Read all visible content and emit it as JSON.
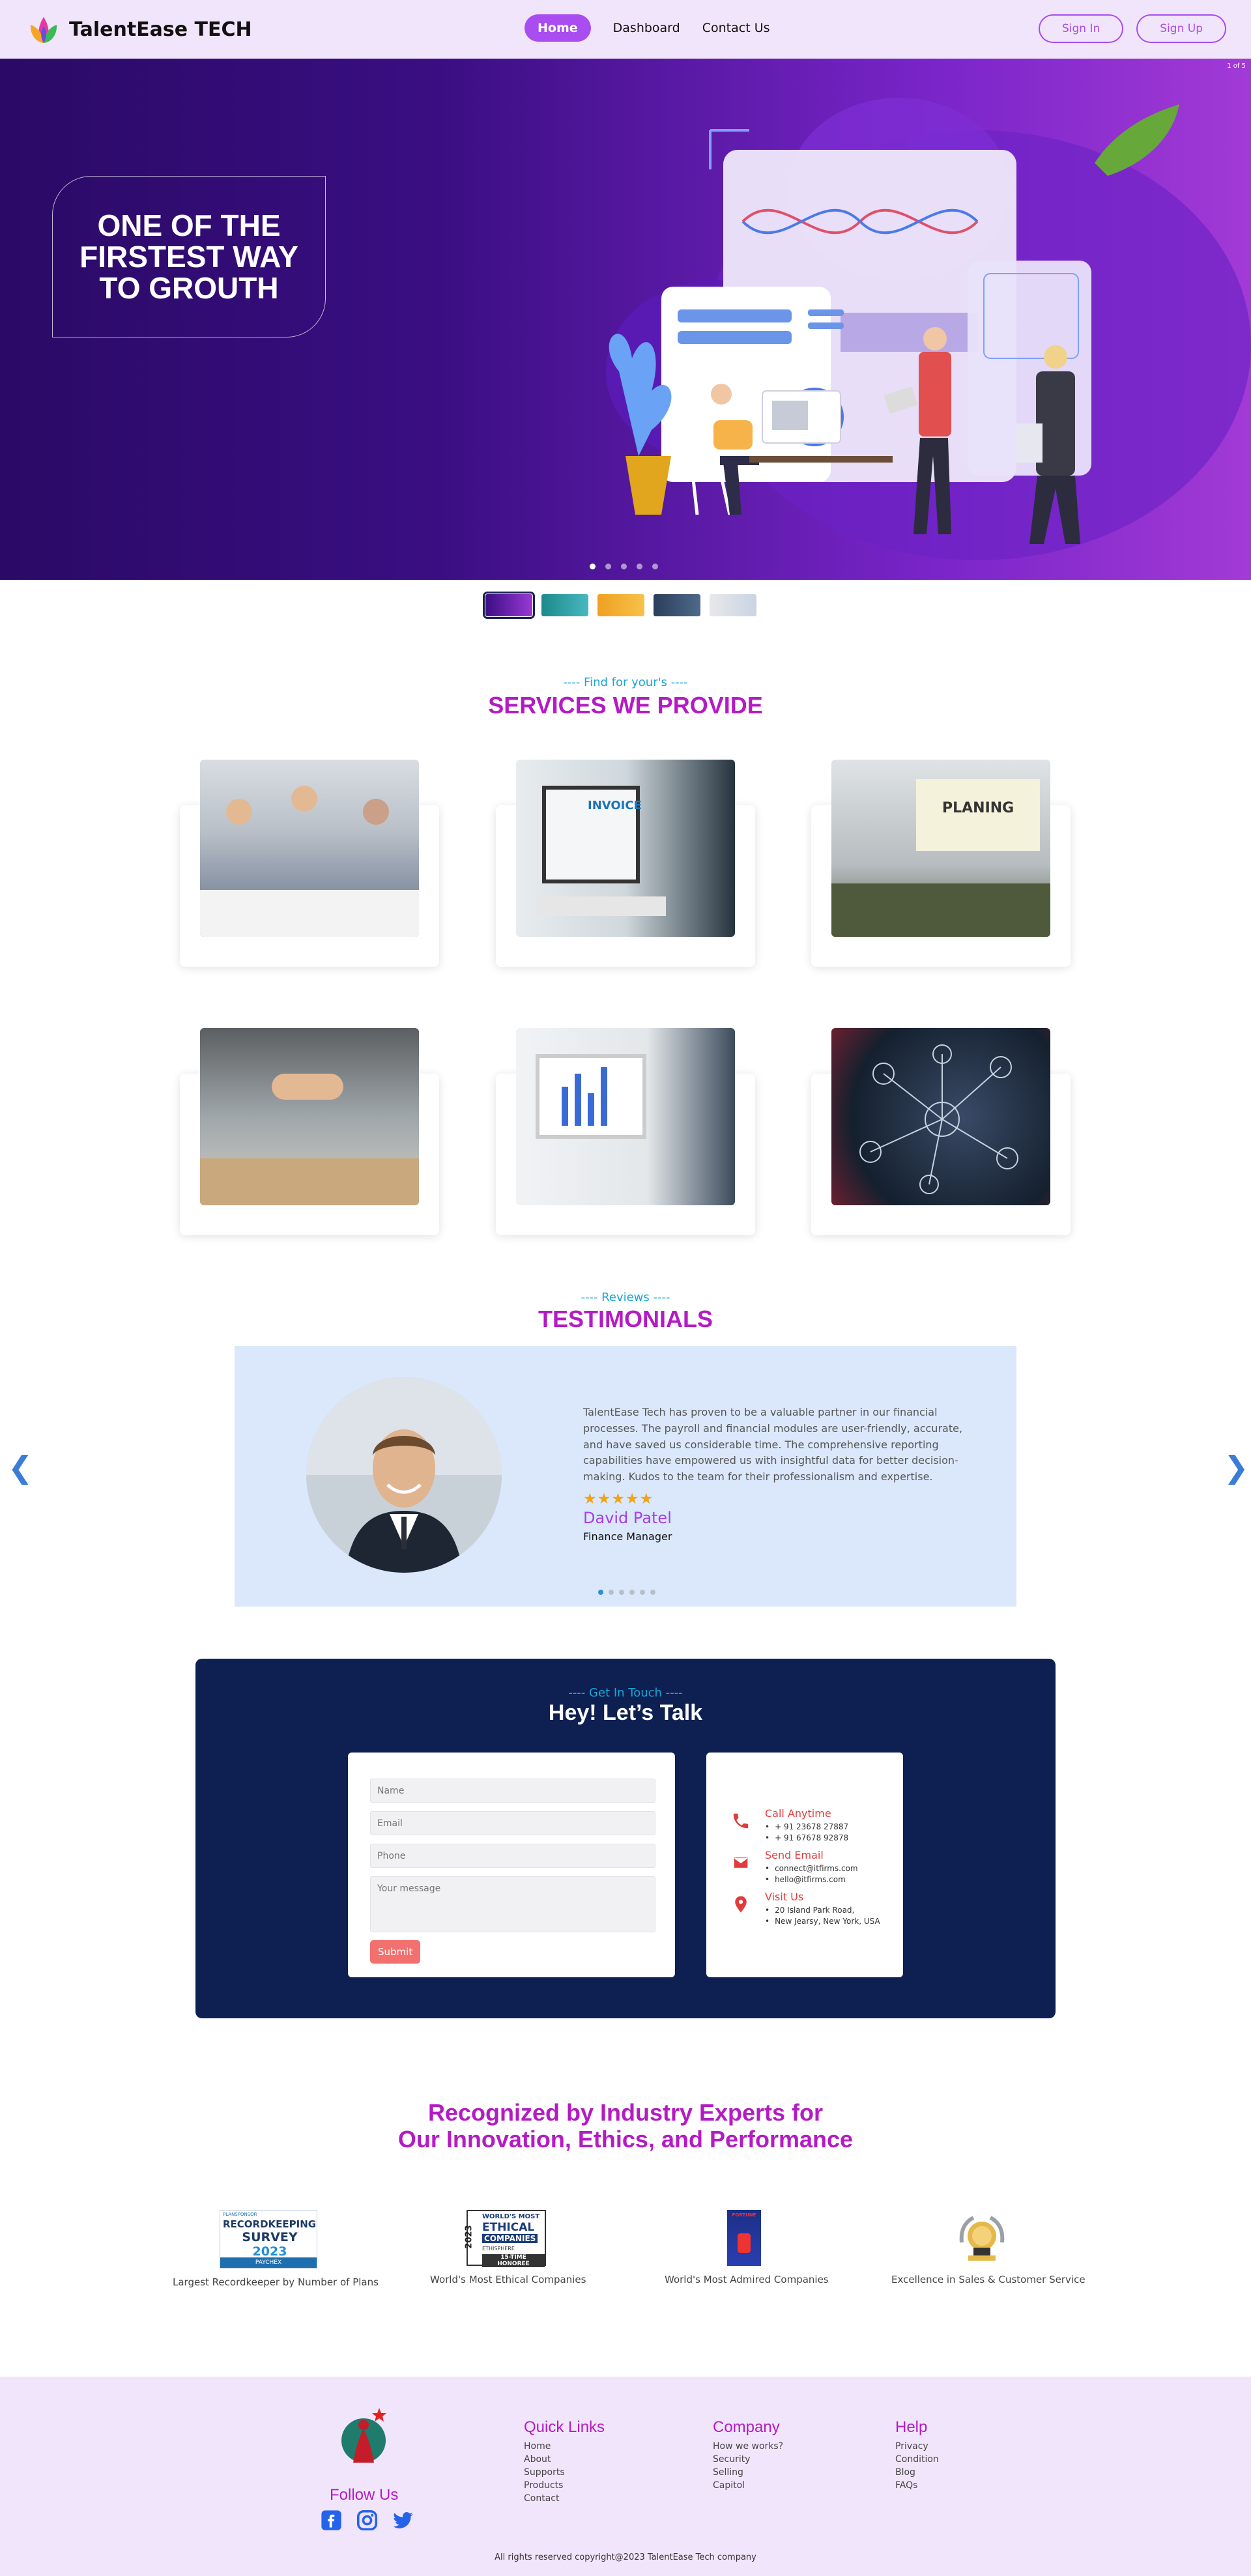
{
  "brand": {
    "name": "TalentEase TECH"
  },
  "nav": {
    "links": [
      {
        "label": "Home",
        "active": true
      },
      {
        "label": "Dashboard"
      },
      {
        "label": "Contact Us"
      }
    ],
    "signin": "Sign In",
    "signup": "Sign Up"
  },
  "hero": {
    "title": "ONE OF THE FIRSTEST WAY TO GROUTH",
    "counter": "1 of 5",
    "slides": 5,
    "active_slide": 1
  },
  "services": {
    "eyebrow": "---- Find for your's ----",
    "title": "SERVICES WE PROVIDE"
  },
  "testimonials": {
    "eyebrow": "---- Reviews ----",
    "title": "TESTIMONIALS",
    "quote": "TalentEase Tech has proven to be a valuable partner in our financial processes. The payroll and financial modules are user-friendly, accurate, and have saved us considerable time. The comprehensive reporting capabilities have empowered us with insightful data for better decision-making. Kudos to the team for their professionalism and expertise.",
    "stars": "★★★★★",
    "rating": 5,
    "name": "David Patel",
    "role": "Finance Manager",
    "pages": 6,
    "active_page": 1,
    "prev": "❮",
    "next": "❯"
  },
  "contact": {
    "eyebrow": "---- Get In Touch ----",
    "title": "Hey! Let’s Talk",
    "form": {
      "name_placeholder": "Name",
      "email_placeholder": "Email",
      "phone_placeholder": "Phone",
      "message_placeholder": "Your message",
      "submit": "Submit"
    },
    "call": {
      "title": "Call Anytime",
      "lines": [
        "+ 91 23678 27887",
        "+ 91 67678 92878"
      ]
    },
    "email": {
      "title": "Send Email",
      "lines": [
        "connect@itfirms.com",
        "hello@itfirms.com"
      ]
    },
    "visit": {
      "title": "Visit Us",
      "lines": [
        "20 Island Park Road,",
        "New Jearsy, New York, USA"
      ]
    }
  },
  "recognized": {
    "line1": "Recognized by Industry Experts for",
    "line2": "Our Innovation, Ethics, and Performance",
    "awards": [
      {
        "caption": "Largest Recordkeeper by Number of Plans",
        "logo_small": "PLANSPONSOR",
        "logo_line1": "RECORDKEEPING",
        "logo_line2": "SURVEY",
        "logo_year": "2023",
        "logo_footer": "PAYCHEX"
      },
      {
        "caption": "World's Most Ethical Companies",
        "logo_line1": "WORLD'S MOST",
        "logo_line2": "ETHICAL",
        "logo_line3": "COMPANIES",
        "logo_line4": "ETHISPHERE",
        "logo_line5": "15-TIME HONOREE",
        "logo_year": "2023"
      },
      {
        "caption": "World's Most Admired Companies",
        "logo_small": "FORTUNE"
      },
      {
        "caption": "Excellence in Sales & Customer Service"
      }
    ]
  },
  "footer": {
    "follow": "Follow Us",
    "quick_links": {
      "title": "Quick Links",
      "items": [
        "Home",
        "About",
        "Supports",
        "Products",
        "Contact"
      ]
    },
    "company": {
      "title": "Company",
      "items": [
        "How we works?",
        "Security",
        "Selling",
        "Capitol"
      ]
    },
    "help": {
      "title": "Help",
      "items": [
        "Privacy",
        "Condition",
        "Blog",
        "FAQs"
      ]
    },
    "copyright": "All rights reserved copyright@2023 TalentEase Tech company"
  },
  "colors": {
    "nav_bg": "#f1e5fb",
    "accent": "#a94cf0",
    "heading": "#b41bc4",
    "eyebrow": "#19a7d6",
    "contact_bg": "#0e1f52",
    "testimonial_bg": "#dbe8fc",
    "submit": "#f2706e"
  },
  "icons": [
    "lotus-logo-icon",
    "phone-icon",
    "mail-icon",
    "location-pin-icon",
    "facebook-icon",
    "instagram-icon",
    "twitter-icon",
    "chevron-left-icon",
    "chevron-right-icon",
    "star-icon"
  ]
}
